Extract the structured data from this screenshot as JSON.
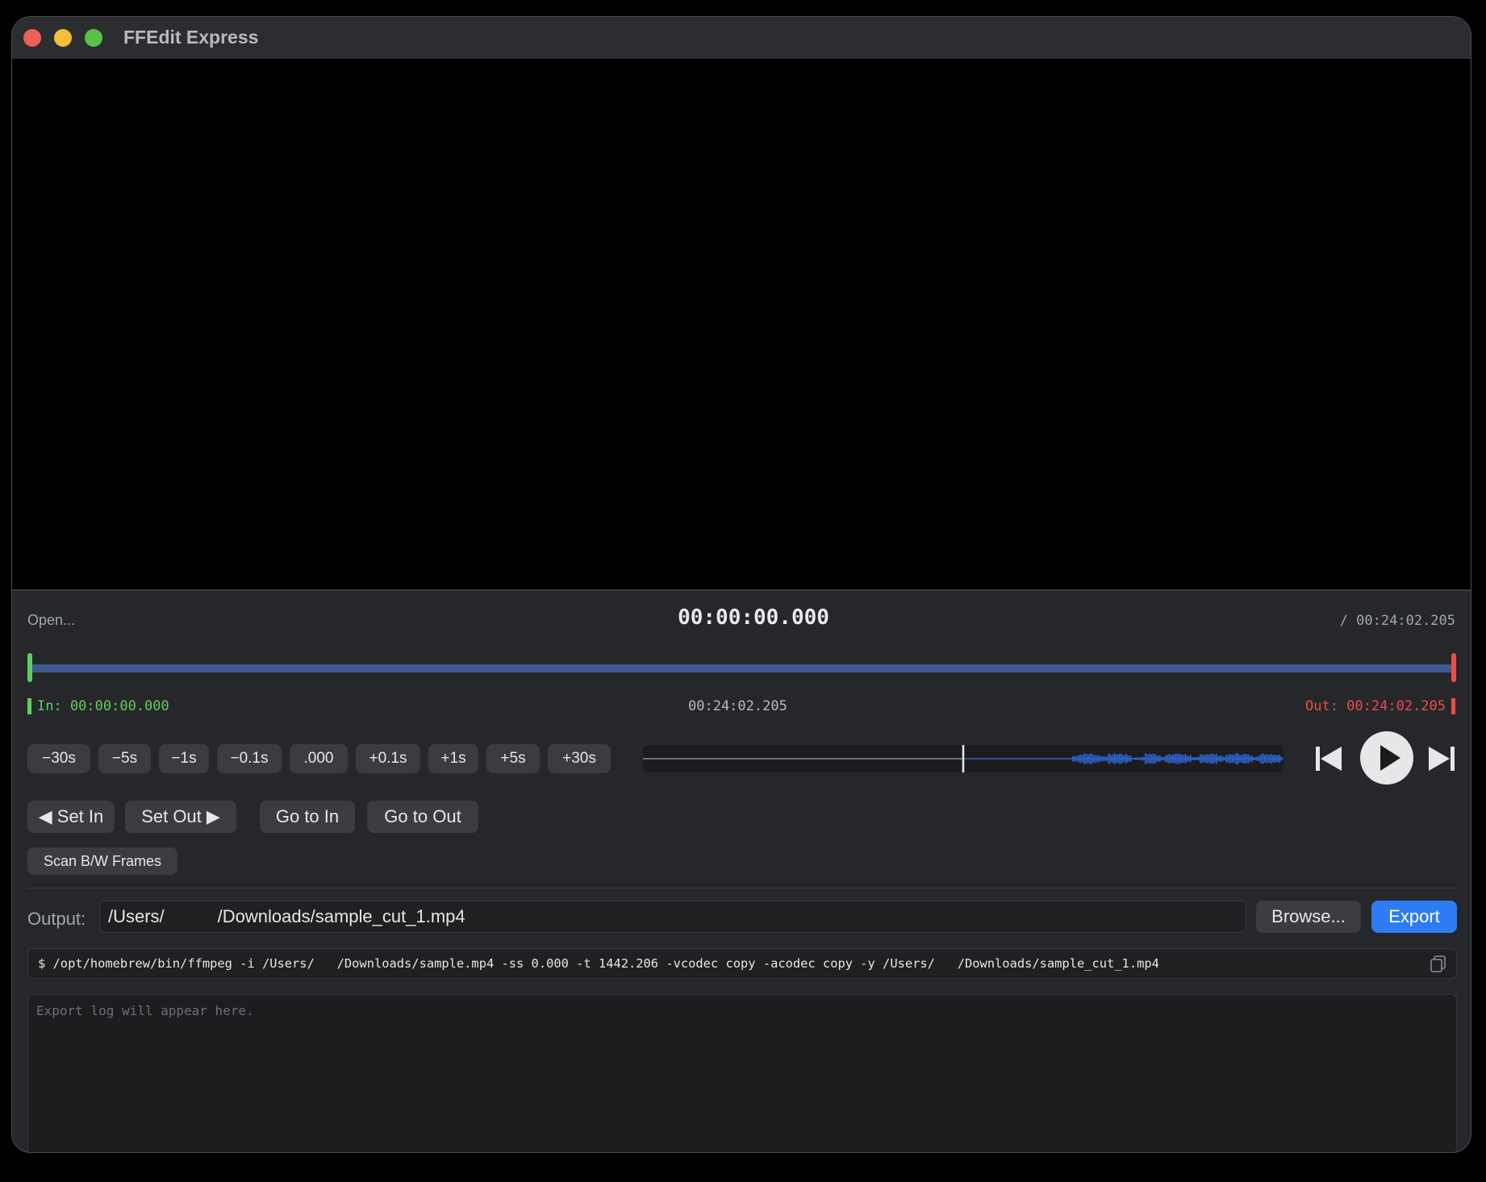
{
  "window": {
    "title": "FFEdit Express"
  },
  "header": {
    "open_label": "Open...",
    "current_time": "00:00:00.000",
    "duration": "/ 00:24:02.205"
  },
  "timeline": {
    "in_label": "In: 00:00:00.000",
    "mid_time": "00:24:02.205",
    "out_label": "Out: 00:24:02.205",
    "playhead_fraction": 0.0,
    "in_color": "#5fcf64",
    "out_color": "#ee4b4b",
    "track_color": "#3d5a8f"
  },
  "nudge_buttons": [
    "−30s",
    "−5s",
    "−1s",
    "−0.1s",
    ".000",
    "+0.1s",
    "+1s",
    "+5s",
    "+30s"
  ],
  "waveform": {
    "playhead_fraction": 0.5,
    "color": "#2f62c9"
  },
  "transport": {
    "prev_icon": "skip-back-icon",
    "play_icon": "play-icon",
    "next_icon": "skip-forward-icon"
  },
  "actions": {
    "set_in": "◀ Set In",
    "set_out": "Set Out ▶",
    "go_to_in": "Go to In",
    "go_to_out": "Go to Out",
    "scan_frames": "Scan B/W Frames"
  },
  "output": {
    "label": "Output:",
    "path": "/Users/   /Downloads/sample_cut_1.mp4",
    "browse_label": "Browse...",
    "export_label": "Export",
    "accent": "#2d7cf3"
  },
  "command": {
    "text": "$ /opt/homebrew/bin/ffmpeg -i /Users/   /Downloads/sample.mp4 -ss 0.000 -t 1442.206 -vcodec copy -acodec copy -y /Users/   /Downloads/sample_cut_1.mp4",
    "copy_icon": "copy-icon"
  },
  "log": {
    "placeholder": "Export log will appear here."
  }
}
